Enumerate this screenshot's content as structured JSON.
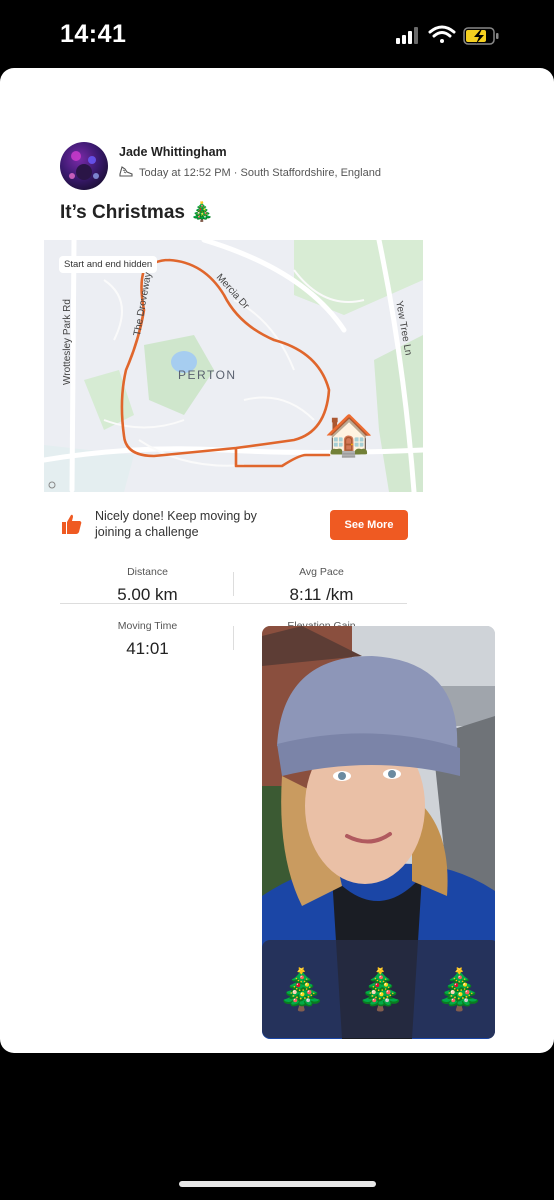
{
  "status_bar": {
    "time": "14:41"
  },
  "post": {
    "author": "Jade Whittingham",
    "meta": "Today at 12:52 PM · South Staffordshire, England",
    "title": "It’s Christmas 🎄",
    "map": {
      "chip": "Start and end hidden",
      "area_label": "PERTON",
      "roads": {
        "wrottesley": "Wrottesley Park Rd",
        "the_droveway": "The Droveway",
        "mercia": "Mercia Dr",
        "yew_tree": "Yew Tree Ln"
      },
      "end_marker": "🏠"
    },
    "challenge": {
      "text": "Nicely done! Keep moving by joining a challenge",
      "button": "See More"
    },
    "stats": {
      "distance_label": "Distance",
      "distance_value": "5.00 km",
      "pace_label": "Avg Pace",
      "pace_value": "8:11 /km",
      "moving_time_label": "Moving Time",
      "moving_time_value": "41:01",
      "elevation_label": "Elevation Gain"
    }
  },
  "selfie_overlay": {
    "trees": [
      "🎄",
      "🎄",
      "🎄"
    ]
  },
  "colors": {
    "accent": "#ef5a22",
    "route": "#e0662c",
    "battery": "#f5d020"
  }
}
